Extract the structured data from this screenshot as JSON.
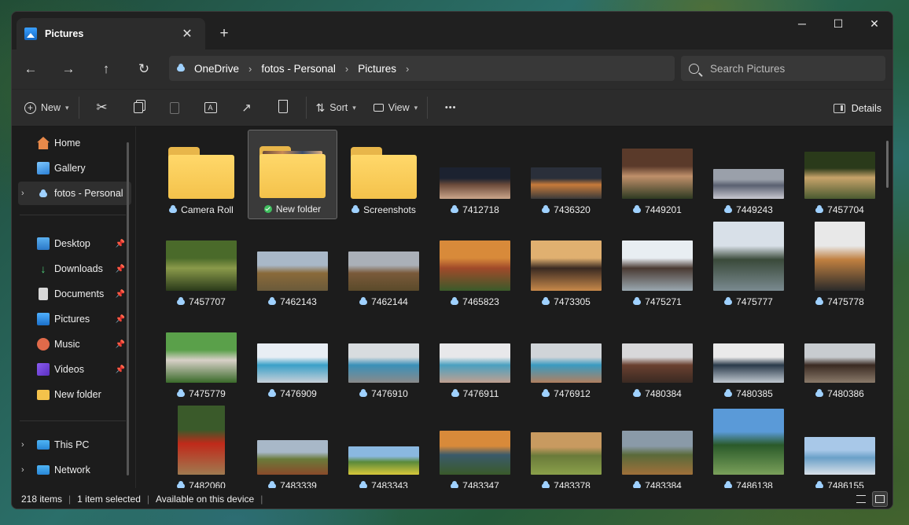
{
  "window": {
    "tab_title": "Pictures",
    "close_tab": "✕",
    "new_tab": "+"
  },
  "nav": {
    "back": "←",
    "forward": "→",
    "up": "↑",
    "refresh": "↻"
  },
  "address": {
    "crumbs": [
      "OneDrive",
      "fotos - Personal",
      "Pictures"
    ],
    "sep": "›"
  },
  "search": {
    "placeholder": "Search Pictures"
  },
  "toolbar": {
    "new_label": "New",
    "sort_label": "Sort",
    "view_label": "View",
    "more": "•••",
    "details_label": "Details"
  },
  "sidebar": {
    "items": [
      {
        "label": "Home",
        "icon": "home-icon"
      },
      {
        "label": "Gallery",
        "icon": "gallery-icon"
      },
      {
        "label": "fotos - Personal",
        "icon": "onedrive-icon"
      },
      {
        "label": "Desktop",
        "icon": "desktop-icon"
      },
      {
        "label": "Downloads",
        "icon": "download-icon"
      },
      {
        "label": "Documents",
        "icon": "documents-icon"
      },
      {
        "label": "Pictures",
        "icon": "pictures-icon"
      },
      {
        "label": "Music",
        "icon": "music-icon"
      },
      {
        "label": "Videos",
        "icon": "videos-icon"
      },
      {
        "label": "New folder",
        "icon": "folder-icon"
      },
      {
        "label": "This PC",
        "icon": "pc-icon"
      },
      {
        "label": "Network",
        "icon": "network-icon"
      }
    ]
  },
  "files": [
    {
      "name": "Camera Roll",
      "kind": "folder"
    },
    {
      "name": "New folder",
      "kind": "folder"
    },
    {
      "name": "Screenshots",
      "kind": "folder"
    },
    {
      "name": "7412718",
      "kind": "image"
    },
    {
      "name": "7436320",
      "kind": "image"
    },
    {
      "name": "7449201",
      "kind": "image"
    },
    {
      "name": "7449243",
      "kind": "image"
    },
    {
      "name": "7457704",
      "kind": "image"
    },
    {
      "name": "7457707",
      "kind": "image"
    },
    {
      "name": "7462143",
      "kind": "image"
    },
    {
      "name": "7462144",
      "kind": "image"
    },
    {
      "name": "7465823",
      "kind": "image"
    },
    {
      "name": "7473305",
      "kind": "image"
    },
    {
      "name": "7475271",
      "kind": "image"
    },
    {
      "name": "7475777",
      "kind": "image"
    },
    {
      "name": "7475778",
      "kind": "image"
    },
    {
      "name": "7475779",
      "kind": "image"
    },
    {
      "name": "7476909",
      "kind": "image"
    },
    {
      "name": "7476910",
      "kind": "image"
    },
    {
      "name": "7476911",
      "kind": "image"
    },
    {
      "name": "7476912",
      "kind": "image"
    },
    {
      "name": "7480384",
      "kind": "image"
    },
    {
      "name": "7480385",
      "kind": "image"
    },
    {
      "name": "7480386",
      "kind": "image"
    },
    {
      "name": "7482060",
      "kind": "image"
    },
    {
      "name": "7483339",
      "kind": "image"
    },
    {
      "name": "7483343",
      "kind": "image"
    },
    {
      "name": "7483347",
      "kind": "image"
    },
    {
      "name": "7483378",
      "kind": "image"
    },
    {
      "name": "7483384",
      "kind": "image"
    },
    {
      "name": "7486138",
      "kind": "image"
    },
    {
      "name": "7486155",
      "kind": "image"
    }
  ],
  "status": {
    "count": "218 items",
    "selected": "1 item selected",
    "availability": "Available on this device",
    "sep": "|"
  },
  "colors": {
    "accent": "#60cdff",
    "folder": "#f4c24b",
    "window_bg": "#1c1c1c"
  }
}
